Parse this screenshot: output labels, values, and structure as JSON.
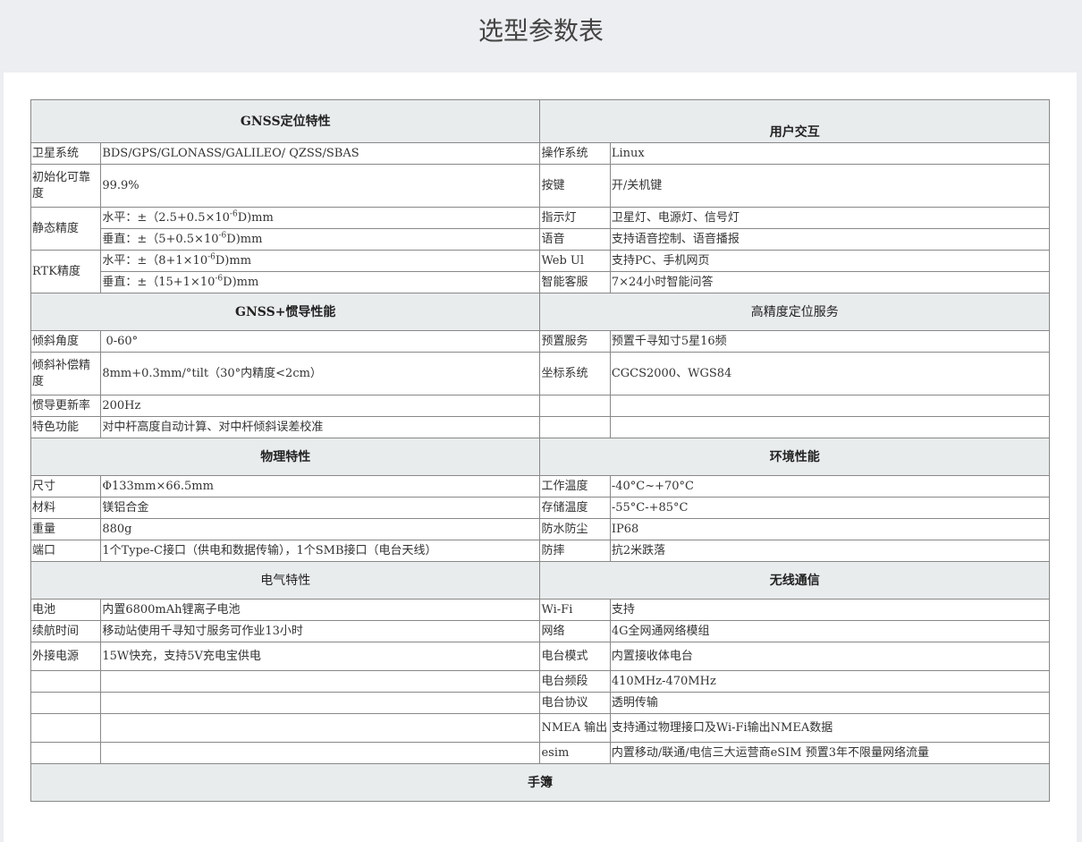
{
  "page_title": "选型参数表",
  "sections": {
    "gnss": "GNSS定位特性",
    "ui": "用户交互",
    "ins": "GNSS+惯导性能",
    "hp": "高精度定位服务",
    "phys": "物理特性",
    "env": "环境性能",
    "elec": "电气特性",
    "wireless": "无线通信",
    "handbook": "手簿"
  },
  "rows": {
    "sat": {
      "label": "卫星系统",
      "value": "BDS/GPS/GLONASS/GALILEO/ QZSS/SBAS"
    },
    "os": {
      "label": "操作系统",
      "value": "Linux"
    },
    "init": {
      "label": "初始化可靠度",
      "value": "99.9%"
    },
    "keys": {
      "label": "按键",
      "value": "开/关机键"
    },
    "static": {
      "label": "静态精度",
      "h_prefix": "水平：±（2.5+0.5×10",
      "h_exp": "-6",
      "h_suffix": "D)mm",
      "v_prefix": "垂直：±（5+0.5×10",
      "v_exp": "-6",
      "v_suffix": "D)mm"
    },
    "led": {
      "label": "指示灯",
      "value": "卫星灯、电源灯、信号灯"
    },
    "voice": {
      "label": "语音",
      "value": "支持语音控制、语音播报"
    },
    "rtk": {
      "label": "RTK精度",
      "h_prefix": "水平：±（8+1×10",
      "h_exp": "-6",
      "h_suffix": "D)mm",
      "v_prefix": "垂直：±（15+1×10",
      "v_exp": "-6",
      "v_suffix": "D)mm"
    },
    "webui": {
      "label": "Web Ul",
      "value": "支持PC、手机网页"
    },
    "cs": {
      "label": "智能客服",
      "value": "7×24小时智能问答"
    },
    "tilt": {
      "label": "倾斜角度",
      "value": " 0-60°"
    },
    "preset": {
      "label": "预置服务",
      "value": "预置千寻知寸5星16频"
    },
    "tiltcomp": {
      "label": "倾斜补偿精度",
      "value": "8mm+0.3mm/°tilt（30°内精度<2cm）"
    },
    "coord": {
      "label": "坐标系统",
      "value": "CGCS2000、WGS84"
    },
    "insrate": {
      "label": "惯导更新率",
      "value": "200Hz"
    },
    "feature": {
      "label": "特色功能",
      "value": "对中杆高度自动计算、对中杆倾斜误差校准"
    },
    "size": {
      "label": "尺寸",
      "value": "Φ133mm×66.5mm"
    },
    "optemp": {
      "label": "工作温度",
      "value": "-40°C~+70°C"
    },
    "material": {
      "label": "材料",
      "value": "镁铝合金"
    },
    "sttemp": {
      "label": "存储温度",
      "value": "-55°C-+85°C"
    },
    "weight": {
      "label": "重量",
      "value": "880g"
    },
    "ip": {
      "label": "防水防尘",
      "value": "IP68"
    },
    "port": {
      "label": "端口",
      "value": "1个Type-C接口（供电和数据传输），1个SMB接口（电台天线）"
    },
    "drop": {
      "label": "防摔",
      "value": "抗2米跌落"
    },
    "battery": {
      "label": "电池",
      "value": "内置6800mAh锂离子电池"
    },
    "wifi": {
      "label": "Wi-Fi",
      "value": "支持"
    },
    "endurance": {
      "label": "续航时间",
      "value": "移动站使用千寻知寸服务可作业13小时"
    },
    "network": {
      "label": "网络",
      "value": "4G全网通网络模组"
    },
    "extpower": {
      "label": "外接电源",
      "value": "15W快充，支持5V充电宝供电"
    },
    "radiomode": {
      "label": "电台模式",
      "value": "内置接收体电台"
    },
    "radiofreq": {
      "label": "电台频段",
      "value": "410MHz-470MHz"
    },
    "radioproto": {
      "label": "电台协议",
      "value": "透明传输"
    },
    "nmea": {
      "label": "NMEA 输出",
      "value": "支持通过物理接口及Wi-Fi输出NMEA数据"
    },
    "esim": {
      "label": "esim",
      "value": "内置移动/联通/电信三大运营商eSIM 预置3年不限量网络流量"
    }
  }
}
